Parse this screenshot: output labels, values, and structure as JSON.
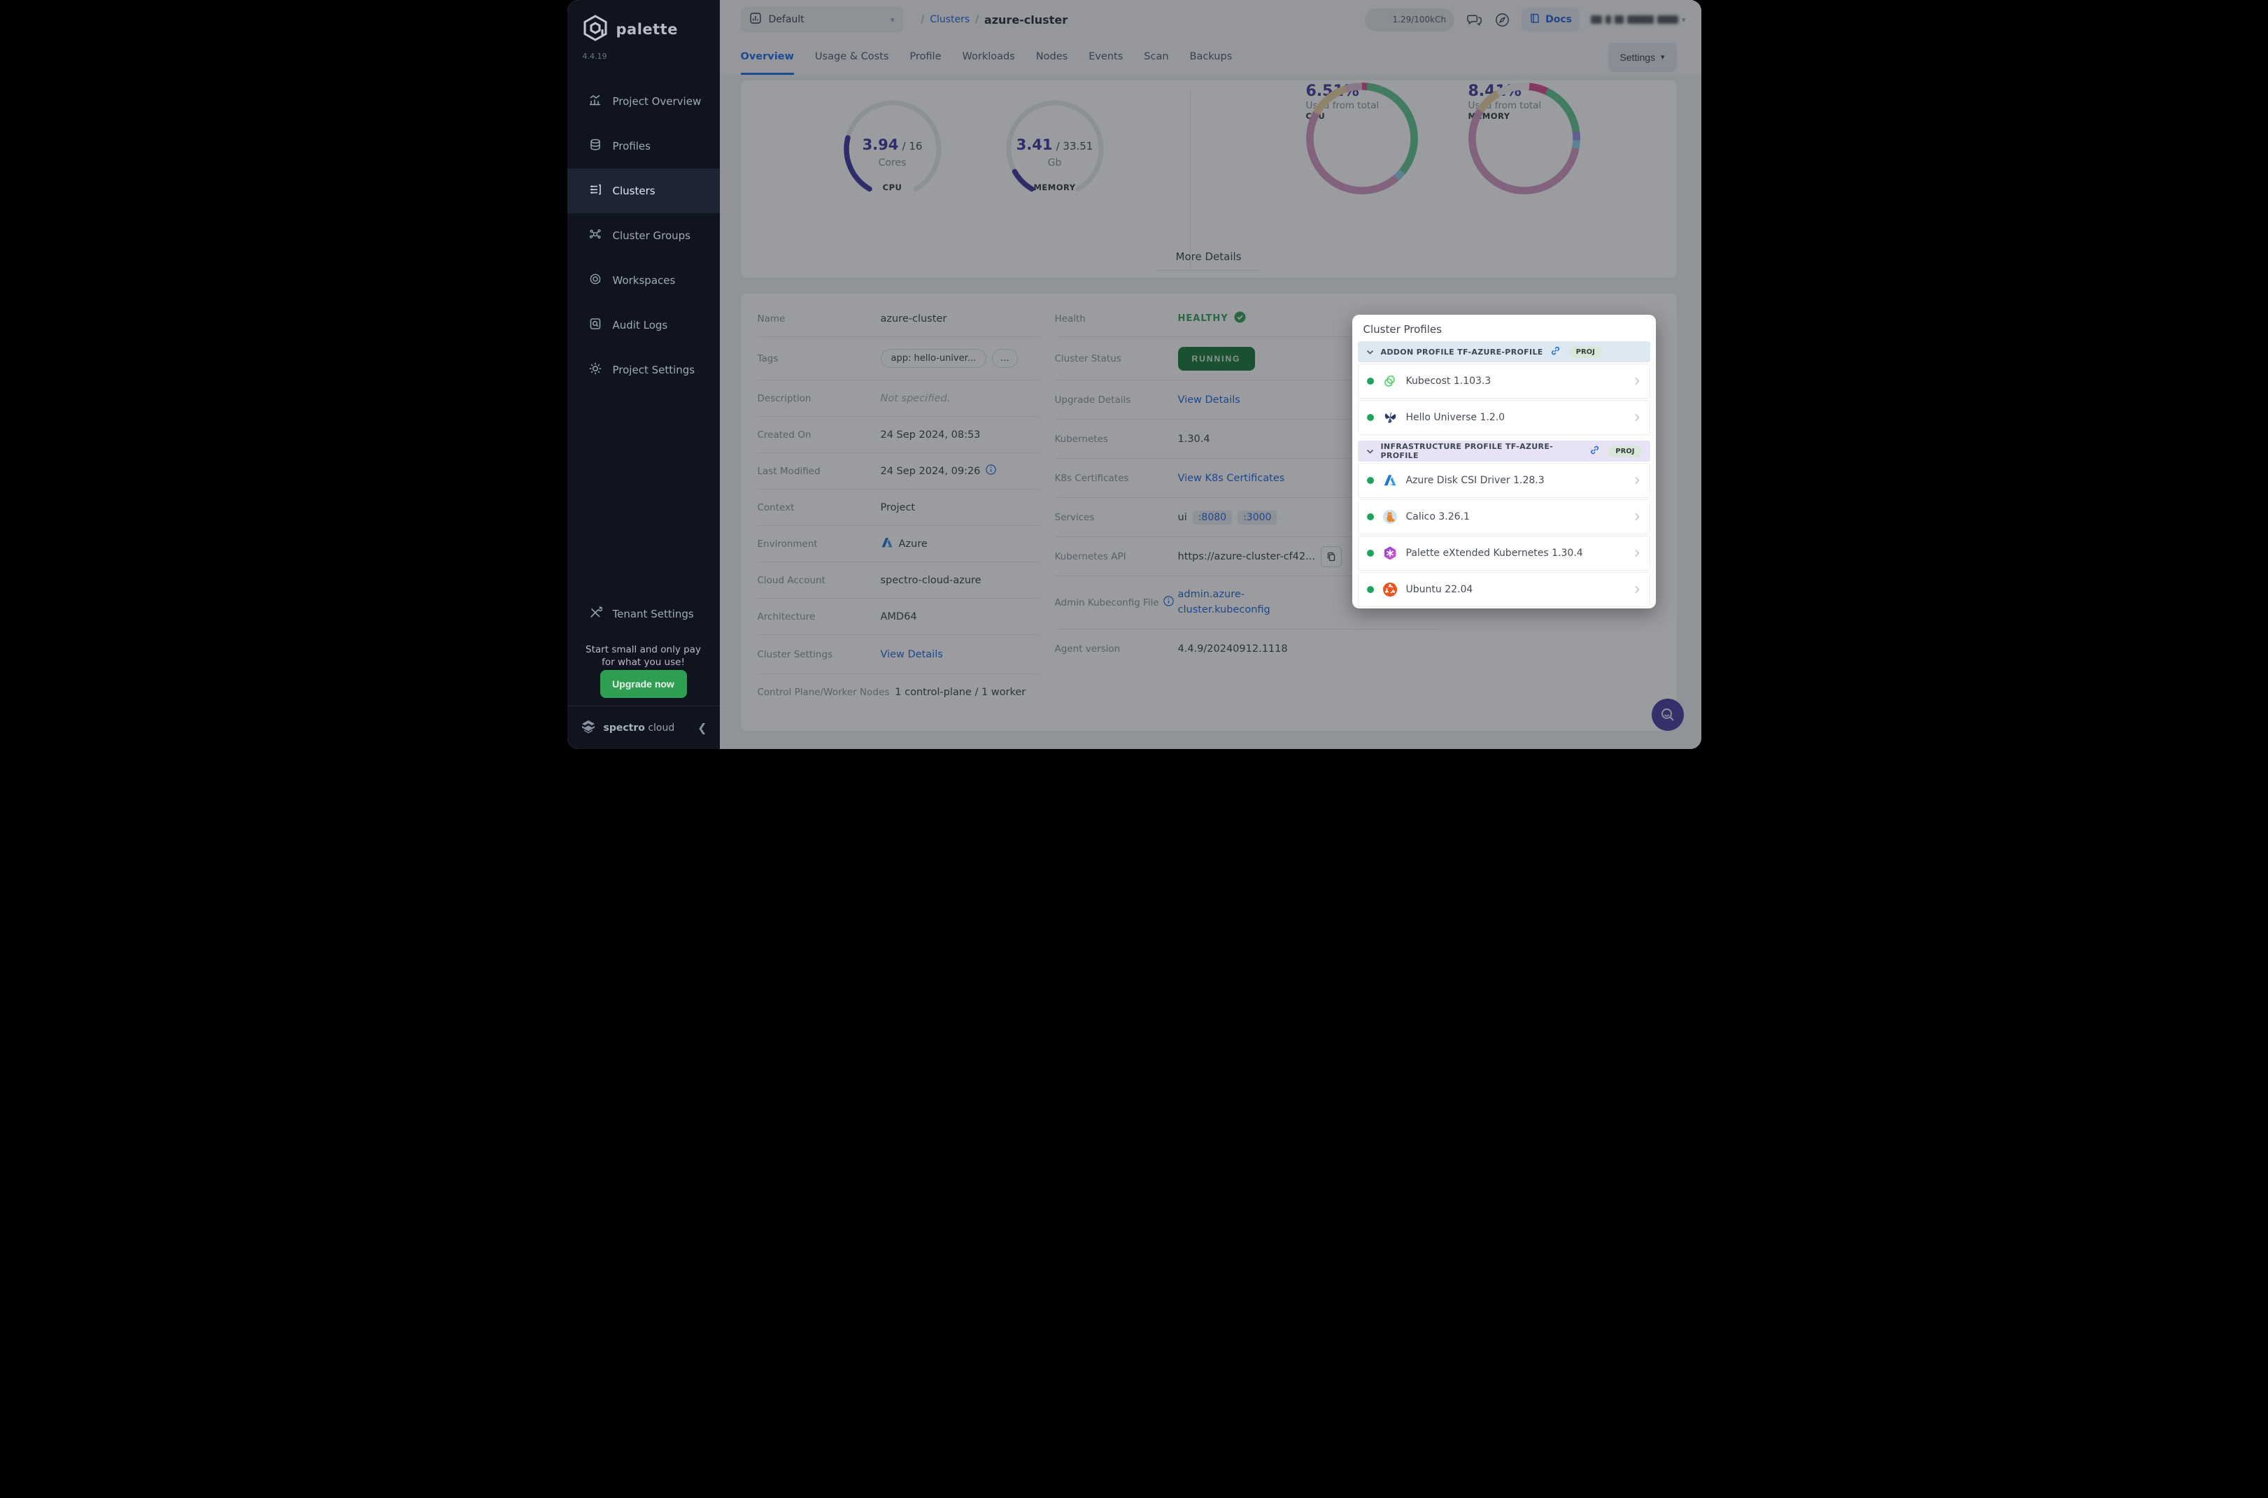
{
  "brand": {
    "name": "palette",
    "version": "4.4.19",
    "footer_bold": "spectro",
    "footer_light": "cloud"
  },
  "sidebar": {
    "items": [
      {
        "label": "Project Overview"
      },
      {
        "label": "Profiles"
      },
      {
        "label": "Clusters"
      },
      {
        "label": "Cluster Groups"
      },
      {
        "label": "Workspaces"
      },
      {
        "label": "Audit Logs"
      },
      {
        "label": "Project Settings"
      }
    ],
    "active": "Clusters",
    "tenant_settings": "Tenant Settings",
    "promo_line1": "Start small and only pay",
    "promo_line2": "for what you use!",
    "upgrade_button": "Upgrade now"
  },
  "topbar": {
    "project_selector": "Default",
    "breadcrumb_root": "/",
    "breadcrumb_section": "Clusters",
    "breadcrumb_separator": "/",
    "breadcrumb_current": "azure-cluster",
    "usage_pill": "1.29/100kCh",
    "docs": "Docs"
  },
  "tabs": {
    "items": [
      {
        "label": "Overview"
      },
      {
        "label": "Usage & Costs"
      },
      {
        "label": "Profile"
      },
      {
        "label": "Workloads"
      },
      {
        "label": "Nodes"
      },
      {
        "label": "Events"
      },
      {
        "label": "Scan"
      },
      {
        "label": "Backups"
      }
    ],
    "active": "Overview",
    "settings_button": "Settings"
  },
  "overview": {
    "cpu_gauge": {
      "value": "3.94",
      "separator": "/",
      "total": "16",
      "unit": "Cores",
      "metric": "CPU",
      "fraction": 0.246
    },
    "memory_gauge": {
      "value": "3.41",
      "separator": "/",
      "total": "33.51",
      "unit": "Gb",
      "metric": "MEMORY",
      "fraction": 0.102
    },
    "cpu_donut": {
      "percent": "6.51%",
      "caption": "Used from total",
      "metric": "CPU"
    },
    "memory_donut": {
      "percent": "8.41%",
      "caption": "Used from total",
      "metric": "MEMORY"
    },
    "more_details": "More Details"
  },
  "details": {
    "left": [
      {
        "label": "Name",
        "value": "azure-cluster"
      },
      {
        "label": "Tags",
        "tag1": "app: hello-univer...",
        "tag2": "..."
      },
      {
        "label": "Description",
        "value": "Not specified."
      },
      {
        "label": "Created On",
        "value": "24 Sep 2024, 08:53"
      },
      {
        "label": "Last Modified",
        "value": "24 Sep 2024, 09:26"
      },
      {
        "label": "Context",
        "value": "Project"
      },
      {
        "label": "Environment",
        "value": "Azure"
      },
      {
        "label": "Cloud Account",
        "value": "spectro-cloud-azure"
      },
      {
        "label": "Architecture",
        "value": "AMD64"
      },
      {
        "label": "Cluster Settings",
        "value": "View Details"
      },
      {
        "label": "Control Plane/Worker Nodes",
        "value": "1 control-plane / 1 worker"
      }
    ],
    "right": [
      {
        "label": "Health",
        "value": "HEALTHY"
      },
      {
        "label": "Cluster Status",
        "value": "RUNNING"
      },
      {
        "label": "Upgrade Details",
        "value": "View Details"
      },
      {
        "label": "Kubernetes",
        "value": "1.30.4"
      },
      {
        "label": "K8s Certificates",
        "value": "View K8s Certificates"
      },
      {
        "label": "Services",
        "value": "ui",
        "port1": ":8080",
        "port2": ":3000"
      },
      {
        "label": "Kubernetes API",
        "value": "https://azure-cluster-cf42..."
      },
      {
        "label": "Admin Kubeconfig File",
        "value": "admin.azure-cluster.kubeconfig"
      },
      {
        "label": "Agent version",
        "value": "4.4.9/20240912.1118"
      }
    ]
  },
  "popup": {
    "title": "Cluster Profiles",
    "sections": [
      {
        "header": "ADDON PROFILE TF-AZURE-PROFILE",
        "badge": "PROJ",
        "items": [
          {
            "name": "Kubecost 1.103.3"
          },
          {
            "name": "Hello Universe 1.2.0"
          }
        ]
      },
      {
        "header": "INFRASTRUCTURE PROFILE TF-AZURE-PROFILE",
        "badge": "PROJ",
        "items": [
          {
            "name": "Azure Disk CSI Driver 1.28.3"
          },
          {
            "name": "Calico 3.26.1"
          },
          {
            "name": "Palette eXtended Kubernetes 1.30.4"
          },
          {
            "name": "Ubuntu 22.04"
          }
        ]
      }
    ]
  }
}
